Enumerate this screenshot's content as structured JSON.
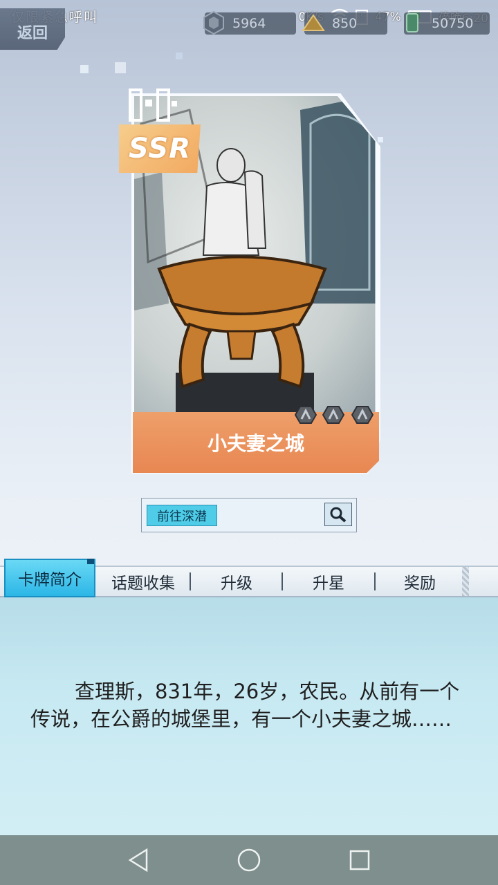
{
  "status_bar": {
    "left_text": "仅限紧急呼叫",
    "net_speed": "0K/s",
    "battery": "47%",
    "time": "傍晚6:20"
  },
  "header": {
    "back_label": "返回",
    "currencies": [
      {
        "name": "crystal",
        "value": "5964",
        "icon": "crystal-icon"
      },
      {
        "name": "gold",
        "value": "850",
        "icon": "gold-icon"
      },
      {
        "name": "stamina",
        "value": "50750",
        "icon": "stamina-icon"
      }
    ]
  },
  "card": {
    "rarity": "SSR",
    "name": "小夫妻之城",
    "stars": 3
  },
  "search": {
    "tag_label": "前往深潜",
    "icon": "search-icon"
  },
  "tabs": [
    {
      "label": "卡牌简介",
      "active": true
    },
    {
      "label": "话题收集",
      "active": false
    },
    {
      "label": "升级",
      "active": false
    },
    {
      "label": "升星",
      "active": false
    },
    {
      "label": "奖励",
      "active": false
    }
  ],
  "description": "查理斯，831年，26岁，农民。从前有一个传说，在公爵的城堡里，有一个小夫妻之城……",
  "nav": [
    "back-nav-icon",
    "home-nav-icon",
    "recent-apps-nav-icon"
  ]
}
